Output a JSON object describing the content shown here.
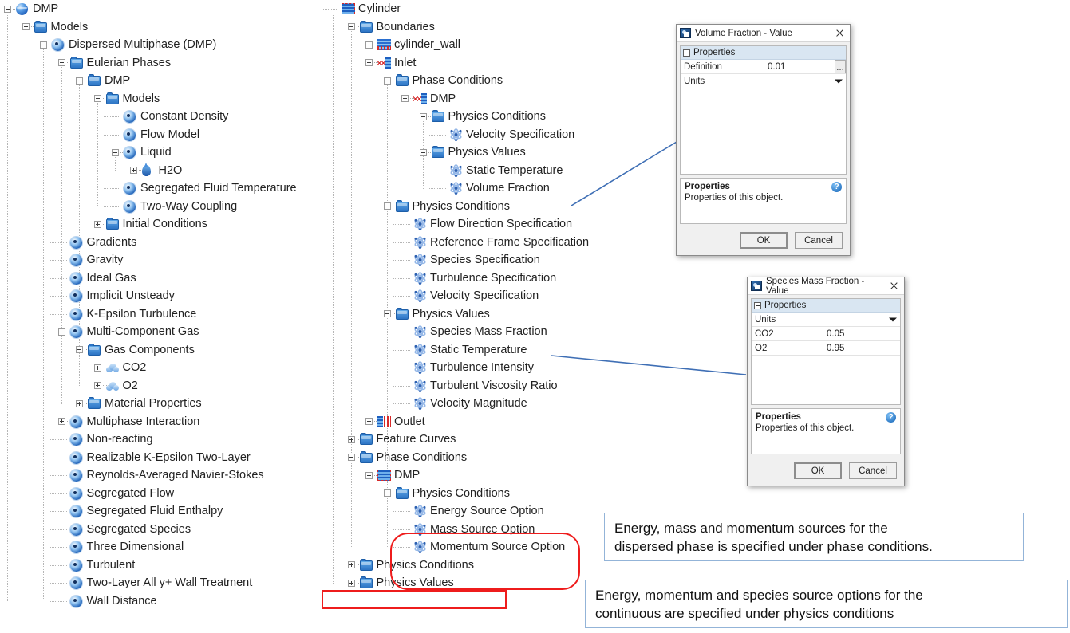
{
  "trees": {
    "left": {
      "name": "simulation-tree-left",
      "nodes": [
        {
          "label": "DMP",
          "depth": 0,
          "icon": "sphere-icon",
          "expander": "minus"
        },
        {
          "label": "Models",
          "depth": 1,
          "icon": "folder-icon",
          "expander": "minus"
        },
        {
          "label": "Dispersed Multiphase (DMP)",
          "depth": 2,
          "icon": "node-icon",
          "expander": "minus"
        },
        {
          "label": "Eulerian Phases",
          "depth": 3,
          "icon": "folder-icon",
          "expander": "minus"
        },
        {
          "label": "DMP",
          "depth": 4,
          "icon": "folder-icon",
          "expander": "minus"
        },
        {
          "label": "Models",
          "depth": 5,
          "icon": "folder-icon",
          "expander": "minus"
        },
        {
          "label": "Constant Density",
          "depth": 6,
          "icon": "node-icon",
          "expander": "none"
        },
        {
          "label": "Flow Model",
          "depth": 6,
          "icon": "node-icon",
          "expander": "none"
        },
        {
          "label": "Liquid",
          "depth": 6,
          "icon": "node-icon",
          "expander": "minus"
        },
        {
          "label": "H2O",
          "depth": 7,
          "icon": "drop-icon",
          "expander": "plus"
        },
        {
          "label": "Segregated Fluid Temperature",
          "depth": 6,
          "icon": "node-icon",
          "expander": "none"
        },
        {
          "label": "Two-Way Coupling",
          "depth": 6,
          "icon": "node-icon",
          "expander": "none"
        },
        {
          "label": "Initial Conditions",
          "depth": 5,
          "icon": "folder-icon",
          "expander": "plus"
        },
        {
          "label": "Gradients",
          "depth": 3,
          "icon": "node-icon",
          "expander": "none"
        },
        {
          "label": "Gravity",
          "depth": 3,
          "icon": "node-icon",
          "expander": "none"
        },
        {
          "label": "Ideal Gas",
          "depth": 3,
          "icon": "node-icon",
          "expander": "none"
        },
        {
          "label": "Implicit Unsteady",
          "depth": 3,
          "icon": "node-icon",
          "expander": "none"
        },
        {
          "label": "K-Epsilon Turbulence",
          "depth": 3,
          "icon": "node-icon",
          "expander": "none"
        },
        {
          "label": "Multi-Component Gas",
          "depth": 3,
          "icon": "node-icon",
          "expander": "minus"
        },
        {
          "label": "Gas Components",
          "depth": 4,
          "icon": "folder-icon",
          "expander": "minus"
        },
        {
          "label": "CO2",
          "depth": 5,
          "icon": "cloud-icon",
          "expander": "plus"
        },
        {
          "label": "O2",
          "depth": 5,
          "icon": "cloud-icon",
          "expander": "plus"
        },
        {
          "label": "Material Properties",
          "depth": 4,
          "icon": "folder-icon",
          "expander": "plus"
        },
        {
          "label": "Multiphase Interaction",
          "depth": 3,
          "icon": "node-icon",
          "expander": "plus"
        },
        {
          "label": "Non-reacting",
          "depth": 3,
          "icon": "node-icon",
          "expander": "none"
        },
        {
          "label": "Realizable K-Epsilon Two-Layer",
          "depth": 3,
          "icon": "node-icon",
          "expander": "none"
        },
        {
          "label": "Reynolds-Averaged Navier-Stokes",
          "depth": 3,
          "icon": "node-icon",
          "expander": "none"
        },
        {
          "label": "Segregated Flow",
          "depth": 3,
          "icon": "node-icon",
          "expander": "none"
        },
        {
          "label": "Segregated Fluid Enthalpy",
          "depth": 3,
          "icon": "node-icon",
          "expander": "none"
        },
        {
          "label": "Segregated Species",
          "depth": 3,
          "icon": "node-icon",
          "expander": "none"
        },
        {
          "label": "Three Dimensional",
          "depth": 3,
          "icon": "node-icon",
          "expander": "none"
        },
        {
          "label": "Turbulent",
          "depth": 3,
          "icon": "node-icon",
          "expander": "none"
        },
        {
          "label": "Two-Layer All y+ Wall Treatment",
          "depth": 3,
          "icon": "node-icon",
          "expander": "none"
        },
        {
          "label": "Wall Distance",
          "depth": 3,
          "icon": "node-icon",
          "expander": "none"
        }
      ]
    },
    "middle": {
      "name": "simulation-tree-middle",
      "nodes": [
        {
          "label": "Cylinder",
          "depth": 0,
          "icon": "region-icon",
          "expander": "none"
        },
        {
          "label": "Boundaries",
          "depth": 1,
          "icon": "folder-icon",
          "expander": "minus"
        },
        {
          "label": "cylinder_wall",
          "depth": 2,
          "icon": "wall-icon",
          "expander": "plus"
        },
        {
          "label": "Inlet",
          "depth": 2,
          "icon": "inlet-icon",
          "expander": "minus"
        },
        {
          "label": "Phase Conditions",
          "depth": 3,
          "icon": "folder-icon",
          "expander": "minus"
        },
        {
          "label": "DMP",
          "depth": 4,
          "icon": "inlet-icon",
          "expander": "minus"
        },
        {
          "label": "Physics Conditions",
          "depth": 5,
          "icon": "folder-icon",
          "expander": "minus"
        },
        {
          "label": "Velocity Specification",
          "depth": 6,
          "icon": "pinwheel-icon",
          "expander": "none"
        },
        {
          "label": "Physics Values",
          "depth": 5,
          "icon": "folder-icon",
          "expander": "minus"
        },
        {
          "label": "Static Temperature",
          "depth": 6,
          "icon": "pinwheel-icon",
          "expander": "none"
        },
        {
          "label": "Volume Fraction",
          "depth": 6,
          "icon": "pinwheel-icon",
          "expander": "none"
        },
        {
          "label": "Physics Conditions",
          "depth": 3,
          "icon": "folder-icon",
          "expander": "minus"
        },
        {
          "label": "Flow Direction Specification",
          "depth": 4,
          "icon": "pinwheel-icon",
          "expander": "none"
        },
        {
          "label": "Reference Frame Specification",
          "depth": 4,
          "icon": "pinwheel-icon",
          "expander": "none"
        },
        {
          "label": "Species Specification",
          "depth": 4,
          "icon": "pinwheel-icon",
          "expander": "none"
        },
        {
          "label": "Turbulence Specification",
          "depth": 4,
          "icon": "pinwheel-icon",
          "expander": "none"
        },
        {
          "label": "Velocity Specification",
          "depth": 4,
          "icon": "pinwheel-icon",
          "expander": "none"
        },
        {
          "label": "Physics Values",
          "depth": 3,
          "icon": "folder-icon",
          "expander": "minus"
        },
        {
          "label": "Species Mass Fraction",
          "depth": 4,
          "icon": "pinwheel-icon",
          "expander": "none"
        },
        {
          "label": "Static Temperature",
          "depth": 4,
          "icon": "pinwheel-icon",
          "expander": "none"
        },
        {
          "label": "Turbulence Intensity",
          "depth": 4,
          "icon": "pinwheel-icon",
          "expander": "none"
        },
        {
          "label": "Turbulent Viscosity Ratio",
          "depth": 4,
          "icon": "pinwheel-icon",
          "expander": "none"
        },
        {
          "label": "Velocity Magnitude",
          "depth": 4,
          "icon": "pinwheel-icon",
          "expander": "none"
        },
        {
          "label": "Outlet",
          "depth": 2,
          "icon": "outlet-icon",
          "expander": "plus"
        },
        {
          "label": "Feature Curves",
          "depth": 1,
          "icon": "folder-icon",
          "expander": "plus"
        },
        {
          "label": "Phase Conditions",
          "depth": 1,
          "icon": "folder-icon",
          "expander": "minus"
        },
        {
          "label": "DMP",
          "depth": 2,
          "icon": "region-icon",
          "expander": "minus"
        },
        {
          "label": "Physics Conditions",
          "depth": 3,
          "icon": "folder-icon",
          "expander": "minus"
        },
        {
          "label": "Energy Source Option",
          "depth": 4,
          "icon": "pinwheel-icon",
          "expander": "none"
        },
        {
          "label": "Mass Source Option",
          "depth": 4,
          "icon": "pinwheel-icon",
          "expander": "none"
        },
        {
          "label": "Momentum Source Option",
          "depth": 4,
          "icon": "pinwheel-icon",
          "expander": "none"
        },
        {
          "label": "Physics Conditions",
          "depth": 1,
          "icon": "folder-icon",
          "expander": "plus"
        },
        {
          "label": "Physics Values",
          "depth": 1,
          "icon": "folder-icon",
          "expander": "plus"
        }
      ]
    }
  },
  "dialog_volume_fraction": {
    "title": "Volume Fraction - Value",
    "group_label": "Properties",
    "rows": [
      {
        "key": "Definition",
        "value": "0.01",
        "control": "ellipsis"
      },
      {
        "key": "Units",
        "value": "",
        "control": "dropdown"
      }
    ],
    "help_title": "Properties",
    "help_text": "Properties of this object.",
    "help_badge": "?",
    "ok_label": "OK",
    "cancel_label": "Cancel"
  },
  "dialog_species_mass_fraction": {
    "title": "Species Mass Fraction - Value",
    "group_label": "Properties",
    "rows": [
      {
        "key": "Units",
        "value": "",
        "control": "dropdown"
      },
      {
        "key": "CO2",
        "value": "0.05",
        "control": "none"
      },
      {
        "key": "O2",
        "value": "0.95",
        "control": "none"
      }
    ],
    "help_title": "Properties",
    "help_text": "Properties of this object.",
    "help_badge": "?",
    "ok_label": "OK",
    "cancel_label": "Cancel"
  },
  "callouts": [
    {
      "name": "callout-phase-conditions",
      "line1": "Energy, mass and momentum sources for the",
      "line2": "dispersed phase is specified under phase conditions."
    },
    {
      "name": "callout-physics-conditions",
      "line1": "Energy, momentum and species source options for the",
      "line2": "continuous are specified under physics conditions"
    }
  ],
  "colors": {
    "highlight_red": "#ee1c1c",
    "connector_blue": "#3f6fb5",
    "callout_border": "#93b4d8",
    "folder_blue": "#2d74c4",
    "group_header": "#d9e6f2"
  }
}
